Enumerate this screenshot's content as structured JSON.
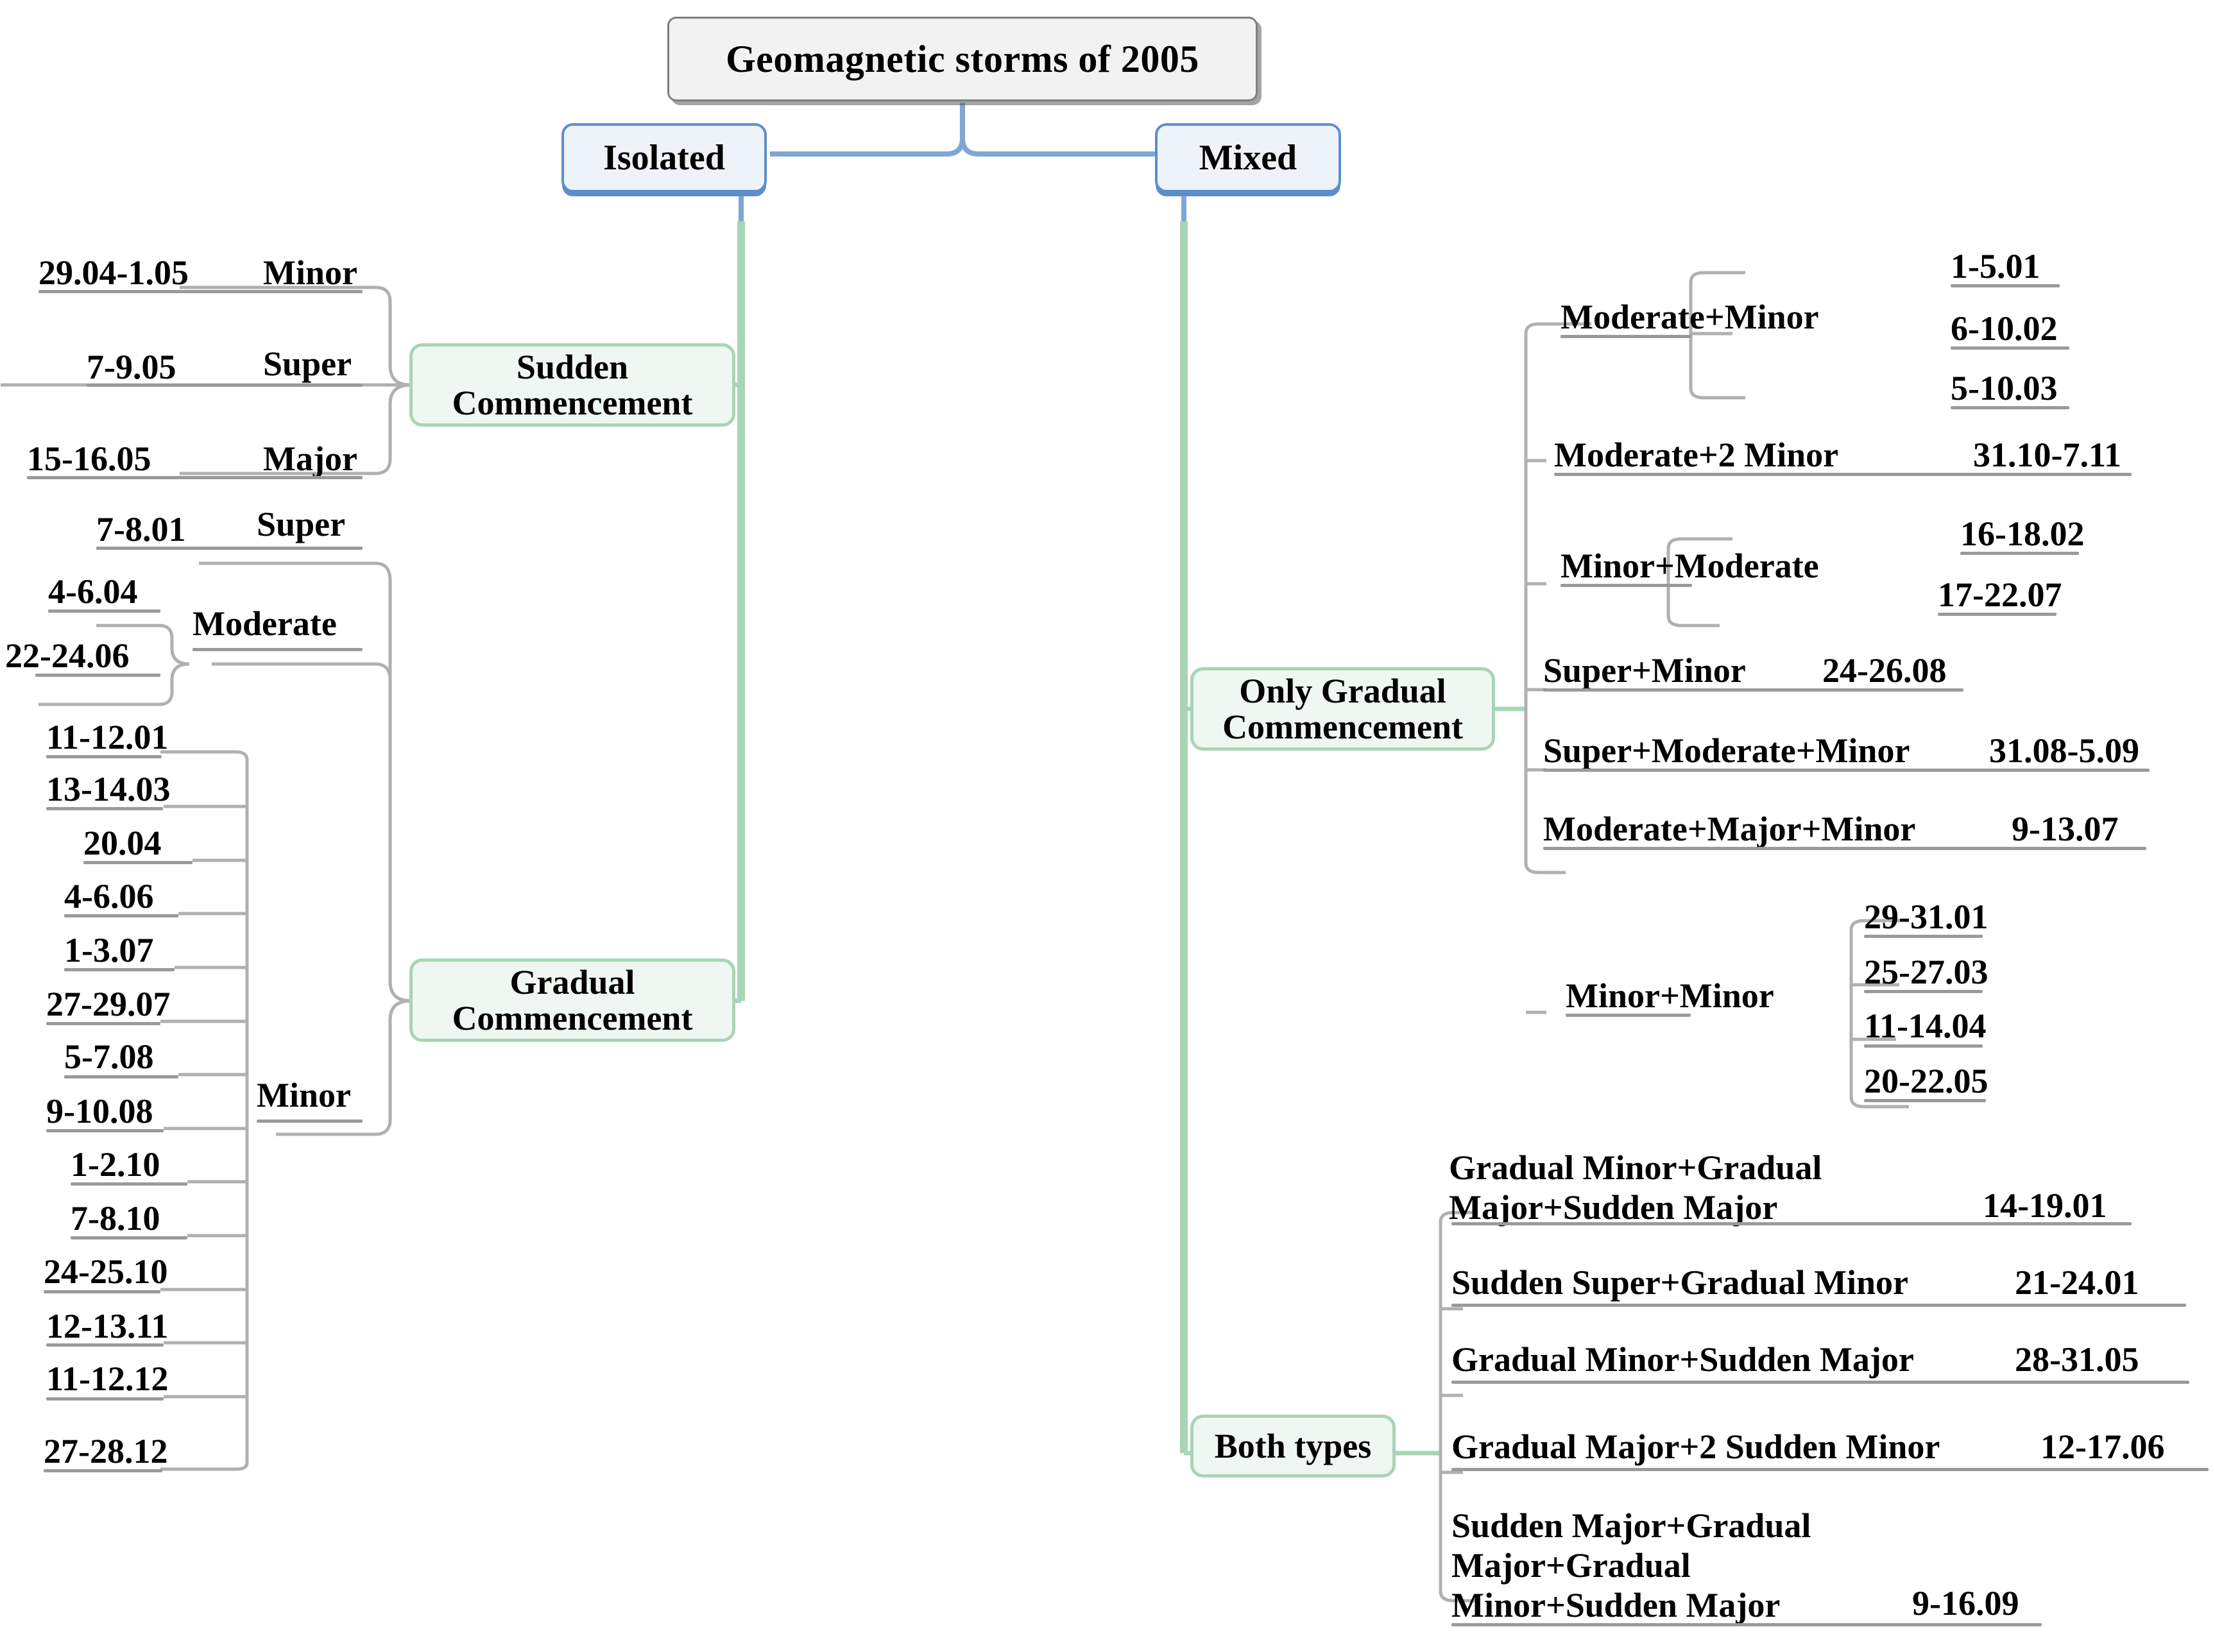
{
  "root": {
    "label": "Geomagnetic storms of 2005"
  },
  "branches": {
    "isolated": {
      "label": "Isolated"
    },
    "mixed": {
      "label": "Mixed"
    }
  },
  "isolated": {
    "sudden": {
      "label_line1": "Sudden",
      "label_line2": "Commencement",
      "classes": [
        {
          "name": "Minor",
          "dates": [
            "29.04-1.05"
          ]
        },
        {
          "name": "Super",
          "dates": [
            "7-9.05"
          ]
        },
        {
          "name": "Major",
          "dates": [
            "15-16.05"
          ]
        }
      ]
    },
    "gradual": {
      "label_line1": "Gradual",
      "label_line2": "Commencement",
      "classes": [
        {
          "name": "Super",
          "dates": [
            "7-8.01"
          ]
        },
        {
          "name": "Moderate",
          "dates": [
            "4-6.04",
            "22-24.06"
          ]
        },
        {
          "name": "Minor",
          "dates": [
            "11-12.01",
            "13-14.03",
            "20.04",
            "4-6.06",
            "1-3.07",
            "27-29.07",
            "5-7.08",
            "9-10.08",
            "1-2.10",
            "7-8.10",
            "24-25.10",
            "12-13.11",
            "11-12.12",
            "27-28.12"
          ]
        }
      ]
    }
  },
  "mixed": {
    "only_gradual": {
      "label_line1": "Only Gradual",
      "label_line2": "Commencement",
      "combos": [
        {
          "name": "Moderate+Minor",
          "dates": [
            "1-5.01",
            "6-10.02",
            "5-10.03"
          ]
        },
        {
          "name": "Moderate+2 Minor",
          "inline_date": "31.10-7.11",
          "dates": []
        },
        {
          "name": "Minor+Moderate",
          "dates": [
            "16-18.02",
            "17-22.07"
          ]
        },
        {
          "name": "Super+Minor",
          "inline_date": "24-26.08",
          "dates": []
        },
        {
          "name": "Super+Moderate+Minor",
          "inline_date": "31.08-5.09",
          "dates": []
        },
        {
          "name": "Moderate+Major+Minor",
          "inline_date": "9-13.07",
          "dates": []
        },
        {
          "name": "Minor+Minor",
          "dates": [
            "29-31.01",
            "25-27.03",
            "11-14.04",
            "20-22.05"
          ]
        }
      ]
    },
    "both_types": {
      "label": "Both types",
      "combos": [
        {
          "line1": "Gradual Minor+Gradual",
          "line2": "Major+Sudden Major",
          "inline_date": "14-19.01"
        },
        {
          "line1": "Sudden Super+Gradual Minor",
          "inline_date": "21-24.01"
        },
        {
          "line1": "Gradual Minor+Sudden Major",
          "inline_date": "28-31.05"
        },
        {
          "line1": "Gradual Major+2 Sudden Minor",
          "inline_date": "12-17.06"
        },
        {
          "line1": "Sudden Major+Gradual",
          "line2": "Major+Gradual",
          "line3": "Minor+Sudden Major",
          "inline_date": "9-16.09"
        }
      ]
    }
  },
  "colors": {
    "root_border": "#7f7f7f",
    "blue_border": "#5b8fc9",
    "green_border": "#a8d5b5",
    "connector": "#b0b0b0"
  }
}
